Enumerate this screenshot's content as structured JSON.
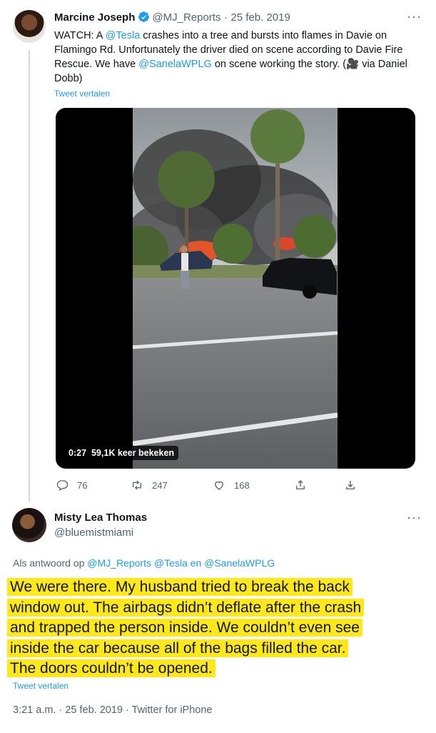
{
  "tweet1": {
    "name": "Marcine Joseph",
    "handle": "@MJ_Reports",
    "separator": "·",
    "date": "25 feb. 2019",
    "more": "···",
    "text_part1": "WATCH: A ",
    "mention_tesla": "@Tesla",
    "text_part2": " crashes into a tree and bursts into flames in Davie on Flamingo Rd. Unfortunately the driver died on scene according to Davie Fire Rescue. We have ",
    "mention_sanela": "@SanelaWPLG",
    "text_part3": " on scene working the story.  (🎥 via Daniel Dobb)",
    "translate": "Tweet vertalen",
    "video": {
      "duration": "0:27",
      "views": "59,1K keer bekeken"
    },
    "actions": {
      "replies": "76",
      "retweets": "247",
      "likes": "168"
    },
    "icons": [
      "verified-badge-icon",
      "more-icon",
      "reply-icon",
      "retweet-icon",
      "like-icon",
      "share-icon",
      "download-icon"
    ],
    "colors": {
      "accent": "#1d9bf0",
      "muted": "#536471"
    }
  },
  "tweet2": {
    "name": "Misty Lea Thomas",
    "handle": "@bluemistmiami",
    "more": "···",
    "reply_prefix": "Als antwoord op ",
    "reply_mentions": "@MJ_Reports @Tesla en @SanelaWPLG",
    "lines": [
      "We were there.  My husband tried to break the back",
      "window out.  The airbags didn’t deflate after the crash",
      "and trapped the person inside.  We couldn’t even see",
      "inside the car because all of the bags filled the car.",
      "The doors couldn’t be opened."
    ],
    "highlight_color": "#ffe81a",
    "translate": "Tweet vertalen",
    "time": "3:21 a.m.",
    "date": "25 feb. 2019",
    "source": "Twitter for iPhone",
    "separator": "·"
  }
}
